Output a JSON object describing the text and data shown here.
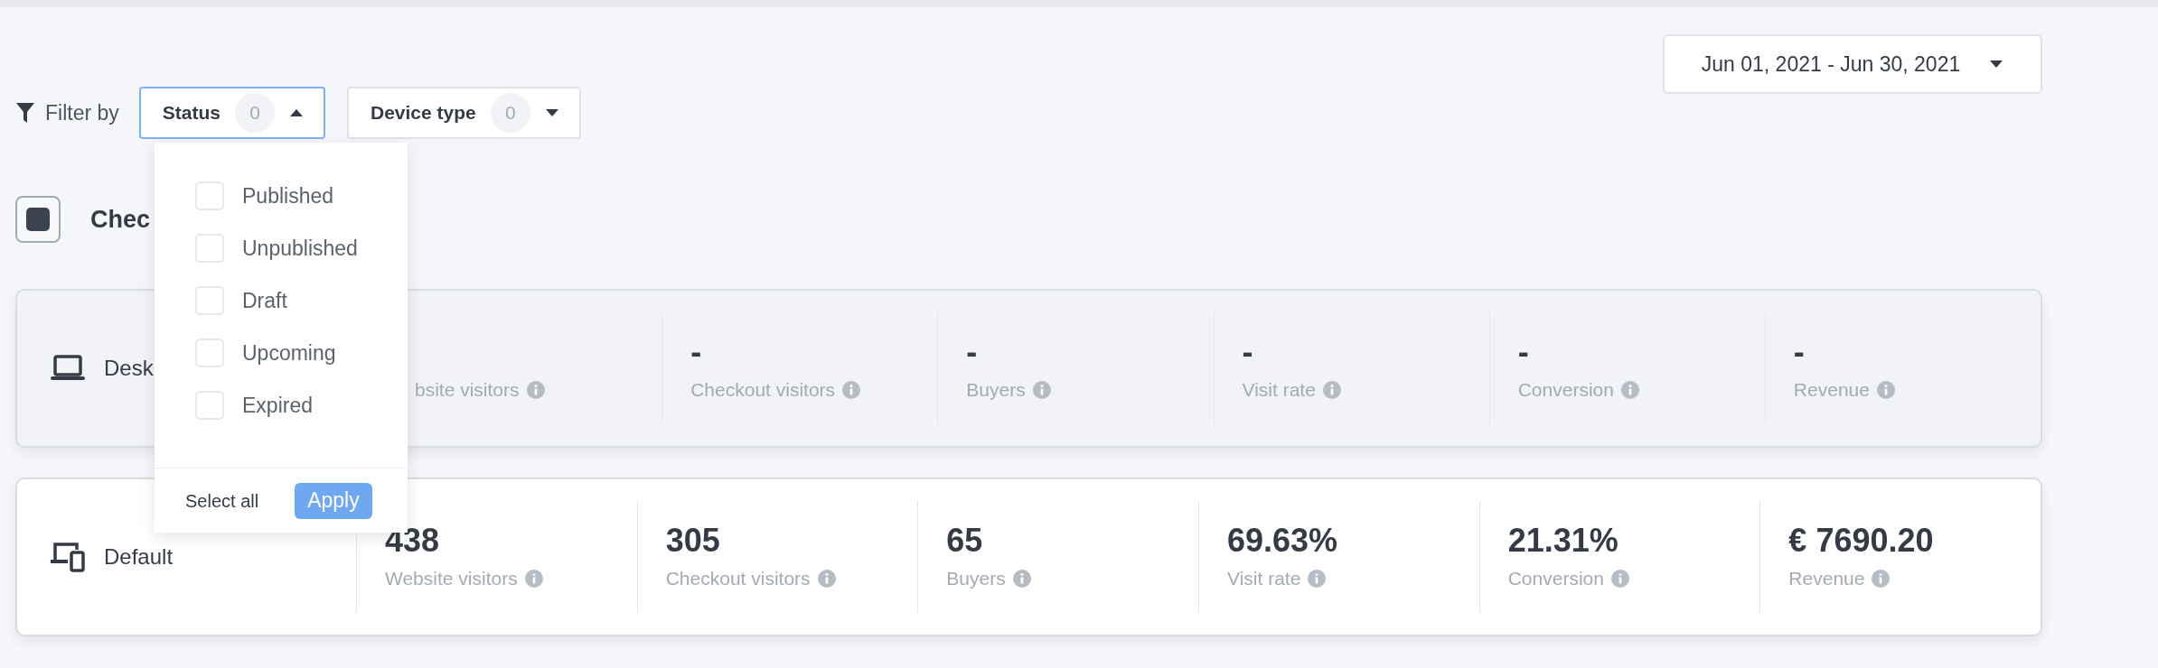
{
  "date_range": {
    "label": "Jun 01, 2021 - Jun 30, 2021"
  },
  "filter": {
    "label": "Filter by",
    "dropdowns": [
      {
        "label": "Status",
        "count": "0",
        "open": true
      },
      {
        "label": "Device type",
        "count": "0",
        "open": false
      }
    ]
  },
  "status_menu": {
    "options": [
      {
        "label": "Published",
        "checked": false
      },
      {
        "label": "Unpublished",
        "checked": false
      },
      {
        "label": "Draft",
        "checked": false
      },
      {
        "label": "Upcoming",
        "checked": false
      },
      {
        "label": "Expired",
        "checked": false
      }
    ],
    "select_all": "Select all",
    "apply": "Apply"
  },
  "master_checkbox": {
    "label": "Chec",
    "checked": true
  },
  "rows": [
    {
      "kind": "laptop",
      "label": "Desk",
      "disabled": true,
      "metrics": [
        {
          "label": "bsite visitors"
        },
        {
          "value": "-",
          "label": "Checkout visitors"
        },
        {
          "value": "-",
          "label": "Buyers"
        },
        {
          "value": "-",
          "label": "Visit rate"
        },
        {
          "value": "-",
          "label": "Conversion"
        },
        {
          "value": "-",
          "label": "Revenue"
        }
      ]
    },
    {
      "kind": "devices",
      "label": "Default",
      "disabled": false,
      "metrics": [
        {
          "value": "438",
          "label": "Website visitors"
        },
        {
          "value": "305",
          "label": "Checkout visitors"
        },
        {
          "value": "65",
          "label": "Buyers"
        },
        {
          "value": "69.63%",
          "label": "Visit rate"
        },
        {
          "value": "21.31%",
          "label": "Conversion"
        },
        {
          "value": "€ 7690.20",
          "label": "Revenue"
        }
      ]
    }
  ]
}
